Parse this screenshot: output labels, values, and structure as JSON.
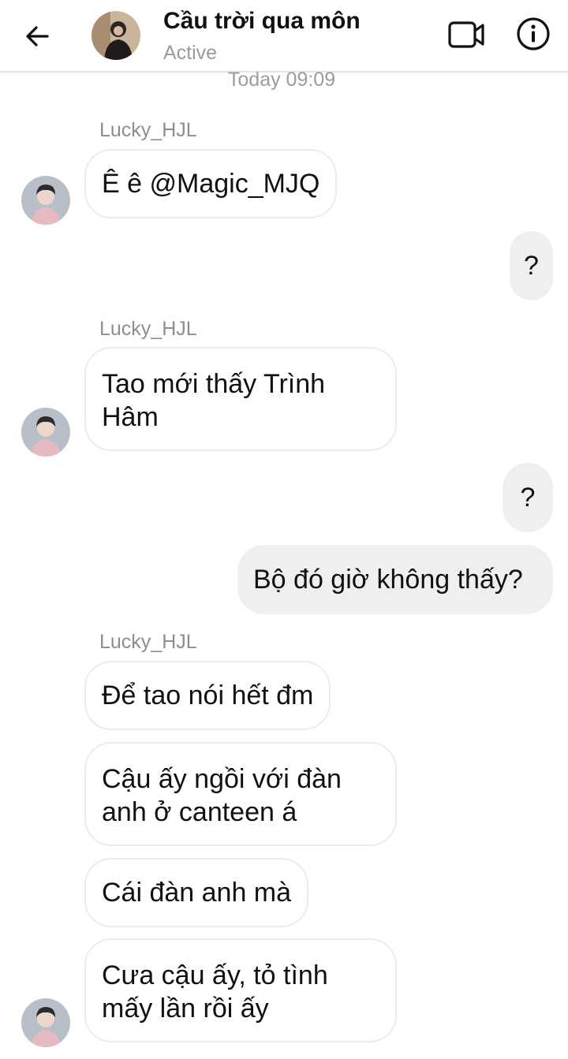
{
  "header": {
    "title": "Cầu trời qua môn",
    "status": "Active"
  },
  "timestamp": "Today 09:09",
  "messages": [
    {
      "sender": "Lucky_HJL",
      "text": "Ê ê @Magic_MJQ"
    },
    {
      "text": "?"
    },
    {
      "sender": "Lucky_HJL",
      "line1": "Tao mới thấy Trình",
      "line2": "Hâm"
    },
    {
      "text": "?"
    },
    {
      "text": "Bộ đó giờ không thấy?"
    },
    {
      "sender": "Lucky_HJL",
      "text": "Để tao nói hết đm"
    },
    {
      "line1": "Cậu ấy ngồi với đàn",
      "line2": "anh ở canteen á"
    },
    {
      "text": "Cái đàn anh mà"
    },
    {
      "line1": "Cưa cậu ấy, tỏ tình",
      "line2": "mấy lần rồi ấy"
    }
  ],
  "icons": {
    "back": "arrow-left-icon",
    "video": "video-camera-icon",
    "info": "info-icon"
  }
}
